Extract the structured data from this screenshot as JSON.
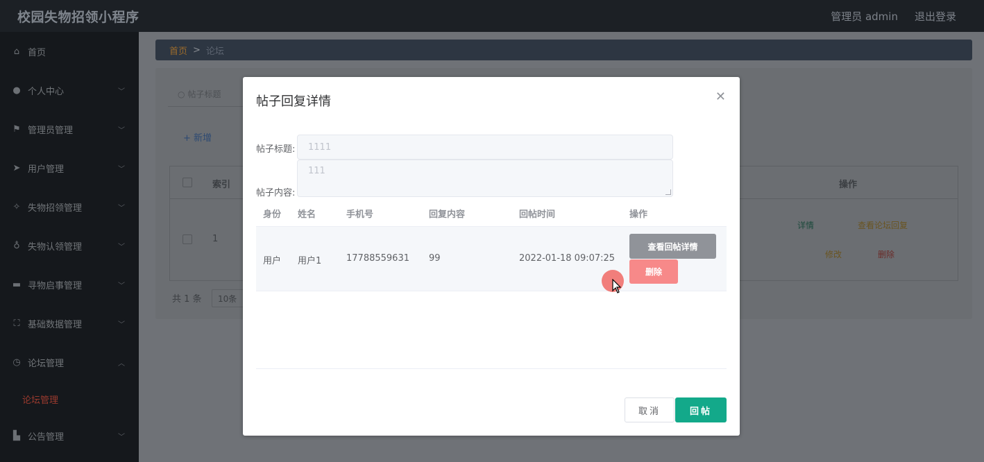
{
  "app": {
    "title": "校园失物招领小程序"
  },
  "header": {
    "user": "管理员 admin",
    "logout": "退出登录"
  },
  "sidebar": {
    "items": [
      {
        "label": "首页",
        "icon": "home-icon",
        "glyph": "⌂",
        "expandable": false
      },
      {
        "label": "个人中心",
        "icon": "user-icon",
        "glyph": "●",
        "expandable": true
      },
      {
        "label": "管理员管理",
        "icon": "flag-icon",
        "glyph": "⚑",
        "expandable": true
      },
      {
        "label": "用户管理",
        "icon": "send-icon",
        "glyph": "➤",
        "expandable": true
      },
      {
        "label": "失物招领管理",
        "icon": "magic-icon",
        "glyph": "✧",
        "expandable": true
      },
      {
        "label": "失物认领管理",
        "icon": "microphone-icon",
        "glyph": "♁",
        "expandable": true
      },
      {
        "label": "寻物启事管理",
        "icon": "message-icon",
        "glyph": "▬",
        "expandable": true
      },
      {
        "label": "基础数据管理",
        "icon": "fullscreen-icon",
        "glyph": "⛶",
        "expandable": true
      },
      {
        "label": "论坛管理",
        "icon": "dashboard-icon",
        "glyph": "◷",
        "expandable": true,
        "open": true
      },
      {
        "label": "公告管理",
        "icon": "thumb-icon",
        "glyph": "▙",
        "expandable": true
      }
    ],
    "subitem": "论坛管理"
  },
  "breadcrumb": {
    "home": "首页",
    "separator": ">",
    "current": "论坛"
  },
  "list": {
    "search_placeholder": "帖子标题",
    "add_label": "+ 新增",
    "columns": [
      "索引",
      "操作"
    ],
    "row": {
      "index": "1"
    },
    "ops": [
      "详情",
      "查看论坛回复",
      "修改",
      "删除"
    ],
    "total": "共 1 条",
    "page_size": "10条"
  },
  "dialog": {
    "title": "帖子回复详情",
    "title_label": "帖子标题:",
    "title_value": "1111",
    "content_label": "帖子内容:",
    "content_value": "111",
    "reply_columns": [
      "身份",
      "姓名",
      "手机号",
      "回复内容",
      "回帖时间",
      "操作"
    ],
    "replies": [
      {
        "role": "用户",
        "name": "用户1",
        "phone": "17788559631",
        "content": "99",
        "time": "2022-01-18 09:07:25"
      }
    ],
    "view_button": "查看回帖详情",
    "delete_button": "删除",
    "cancel_button": "取消",
    "reply_button": "回帖"
  },
  "colors": {
    "primary": "#13a98a",
    "danger": "#f78989",
    "info": "#909399",
    "sidebar_bg": "#15181c"
  }
}
